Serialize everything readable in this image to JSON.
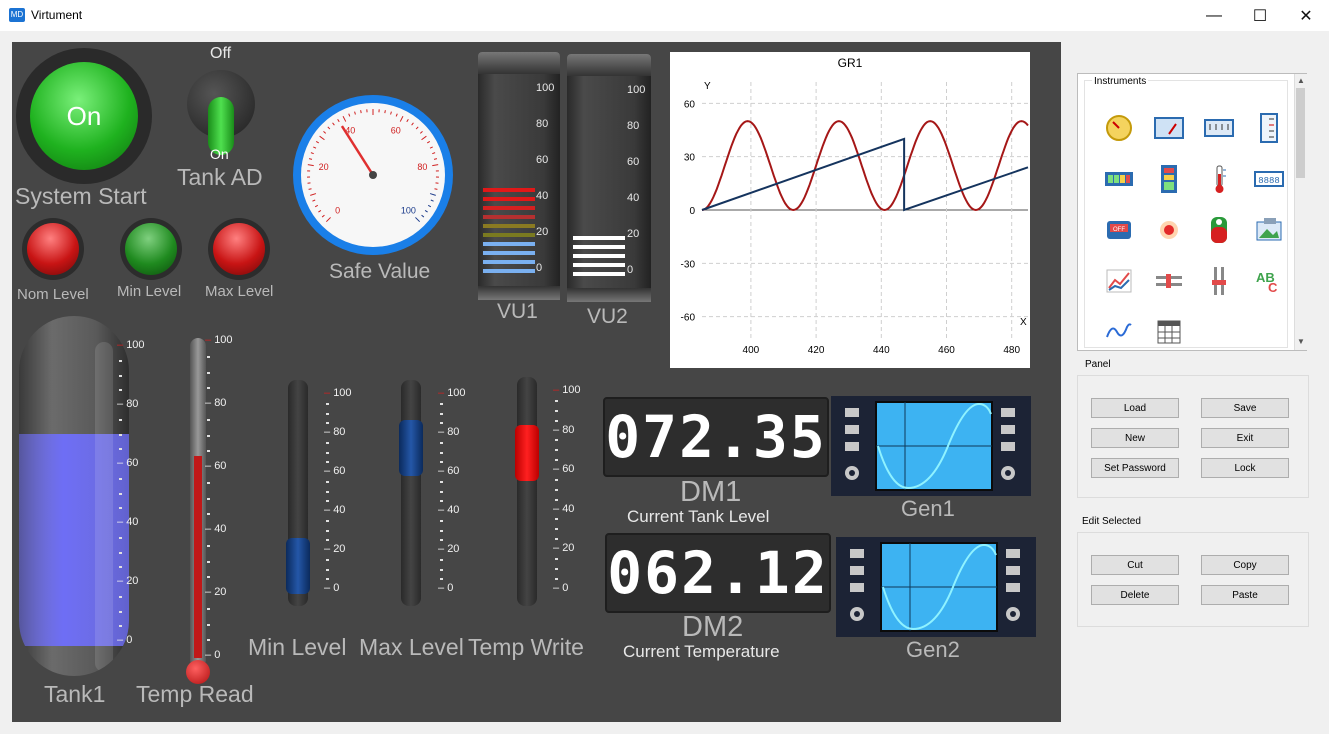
{
  "window": {
    "title": "Virtument",
    "app_icon_text": "MD",
    "minimize_glyph": "—",
    "maximize_glyph": "☐",
    "close_glyph": "✕"
  },
  "instruments": {
    "system_start": {
      "state_text": "On",
      "label": "System Start",
      "color": "#1fb21f"
    },
    "tank_ad": {
      "off_text": "Off",
      "on_text": "On",
      "label": "Tank AD"
    },
    "indicators": [
      {
        "label": "Nom Level",
        "color": "#c81414"
      },
      {
        "label": "Min Level",
        "color": "#1f8a1f"
      },
      {
        "label": "Max Level",
        "color": "#c81414"
      }
    ],
    "safe_value": {
      "label": "Safe Value",
      "ticks": [
        "0",
        "20",
        "40",
        "60",
        "80",
        "100"
      ],
      "value": 38
    },
    "vu1": {
      "label": "VU1",
      "ticks": [
        "100",
        "80",
        "60",
        "40",
        "20",
        "0"
      ]
    },
    "vu2": {
      "label": "VU2",
      "ticks": [
        "100",
        "80",
        "60",
        "40",
        "20",
        "0"
      ]
    },
    "gr1": {
      "title": "GR1",
      "y_axis_name": "Y",
      "x_axis_name": "X",
      "y_ticks": [
        "60",
        "30",
        "0",
        "-30",
        "-60"
      ],
      "x_ticks": [
        "400",
        "420",
        "440",
        "460",
        "480"
      ]
    },
    "tank1": {
      "label": "Tank1",
      "ticks": [
        "100",
        "80",
        "60",
        "40",
        "20",
        "0"
      ],
      "level": 0.72,
      "fill_color": "#6e6ef5"
    },
    "temp_read": {
      "label": "Temp Read",
      "ticks": [
        "100",
        "80",
        "60",
        "40",
        "20",
        "0"
      ],
      "level": 0.65
    },
    "min_level": {
      "label": "Min Level",
      "ticks": [
        "100",
        "80",
        "60",
        "40",
        "20",
        "0"
      ],
      "value": 0.12
    },
    "max_level": {
      "label": "Max Level",
      "ticks": [
        "100",
        "80",
        "60",
        "40",
        "20",
        "0"
      ],
      "value": 0.72
    },
    "temp_write": {
      "label": "Temp Write",
      "ticks": [
        "100",
        "80",
        "60",
        "40",
        "20",
        "0"
      ],
      "value": 0.68
    },
    "dm1": {
      "display": "072.35",
      "name": "DM1",
      "caption": "Current Tank Level"
    },
    "dm2": {
      "display": "062.12",
      "name": "DM2",
      "caption": "Current Temperature"
    },
    "gen1": {
      "label": "Gen1"
    },
    "gen2": {
      "label": "Gen2"
    }
  },
  "sidebar": {
    "instruments_title": "Instruments",
    "palette_icons": [
      "analog-gauge-icon",
      "panel-meter-icon",
      "linear-meter-icon",
      "vertical-scale-icon",
      "battery-bar-icon",
      "level-bar-icon",
      "thermometer-icon",
      "digital-readout-icon",
      "off-switch-icon",
      "lamp-icon",
      "tank-icon",
      "picture-icon",
      "chart-icon",
      "slider-horizontal-icon",
      "slider-vertical-icon",
      "text-label-icon",
      "wave-generator-icon",
      "table-grid-icon"
    ],
    "panel_title": "Panel",
    "panel_buttons": [
      "Load",
      "Save",
      "New",
      "Exit",
      "Set Password",
      "Lock"
    ],
    "edit_title": "Edit Selected",
    "edit_buttons": [
      "Cut",
      "Copy",
      "Delete",
      "Paste"
    ]
  }
}
